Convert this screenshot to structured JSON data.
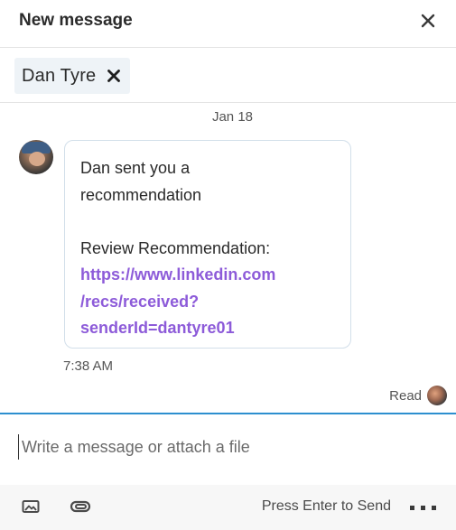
{
  "header": {
    "title": "New message",
    "close_icon": "close-icon"
  },
  "recipients": [
    {
      "name": "Dan Tyre",
      "remove_icon": "remove-x-icon"
    }
  ],
  "conversation": {
    "date_separator": "Jan 18",
    "message": {
      "lines": [
        "Dan sent you a",
        "recommendation"
      ],
      "review_label": "Review Recommendation:",
      "link_lines": [
        "https://www.linkedin.com",
        "/recs/received?",
        "senderId=dantyre01"
      ],
      "time": "7:38 AM"
    },
    "read_receipt": "Read"
  },
  "composer": {
    "placeholder": "Write a message or attach a file",
    "value": "",
    "send_hint": "Press Enter to Send",
    "icons": [
      "image-icon",
      "attachment-icon",
      "more-options-icon"
    ]
  },
  "colors": {
    "accent_blue": "#2d8fcf",
    "link_purple": "#8d5bd9",
    "chip_bg": "#eef3f7",
    "bubble_border": "#d2dfea"
  }
}
